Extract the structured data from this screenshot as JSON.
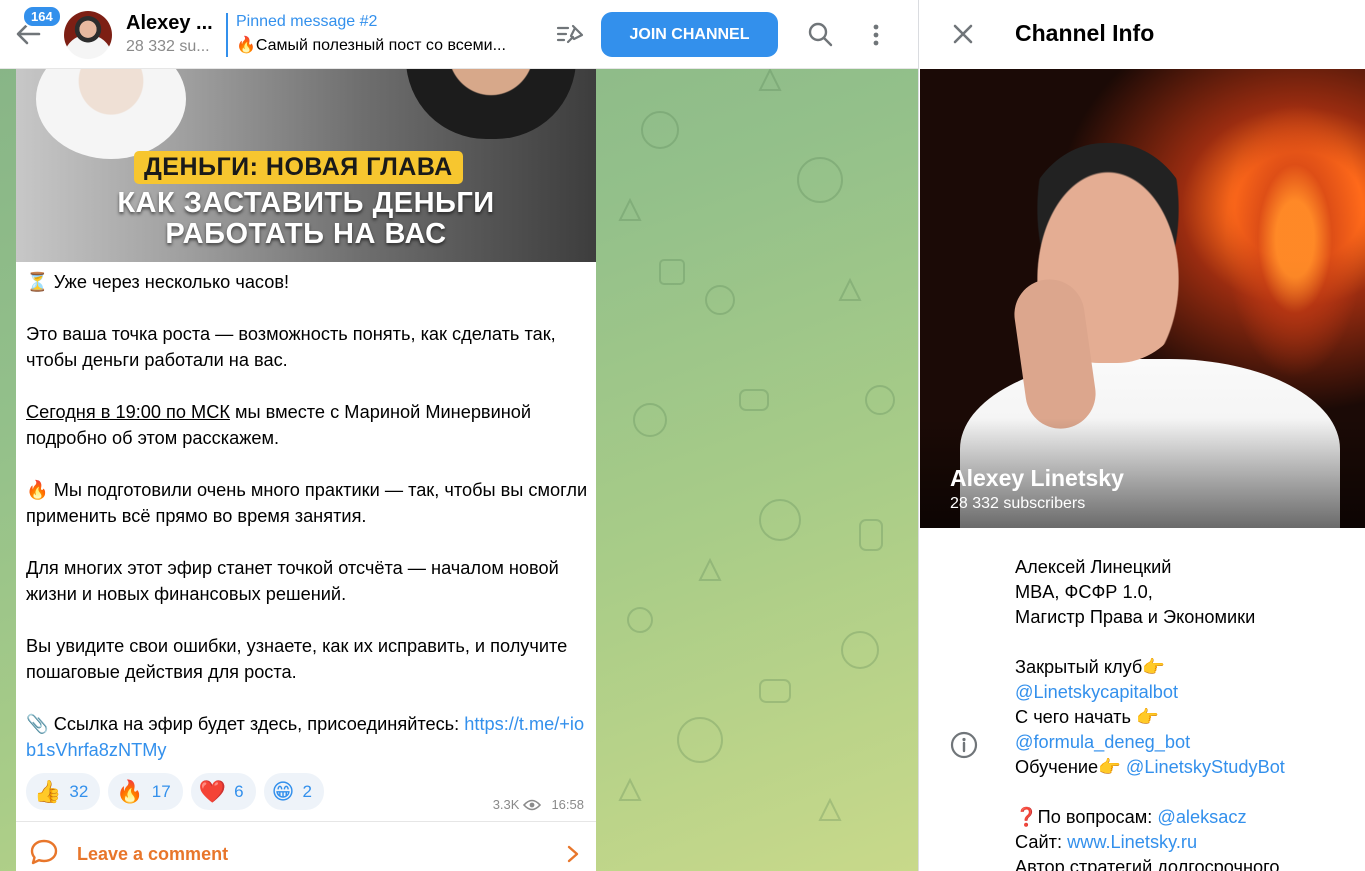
{
  "header": {
    "unread_count": "164",
    "channel_title": "Alexey ...",
    "subscribers": "28 332 su...",
    "pinned_title": "Pinned message #2",
    "pinned_text": "🔥Самый полезный пост со всеми...",
    "join_label": "JOIN CHANNEL"
  },
  "post": {
    "image": {
      "tag": "ДЕНЬГИ: НОВАЯ ГЛАВА",
      "headline_line1": "КАК ЗАСТАВИТЬ ДЕНЬГИ",
      "headline_line2": "РАБОТАТЬ НА ВАС"
    },
    "p1": "⏳ Уже через несколько часов!",
    "p2": "Это ваша точка роста — возможность понять, как сделать так, чтобы деньги работали на вас.",
    "p3_underlined": "Сегодня в 19:00 по МСК",
    "p3_rest": " мы вместе с Мариной Минервиной подробно об этом расскажем.",
    "p4": "🔥 Мы подготовили очень много практики — так, чтобы вы смогли применить всё прямо во время занятия.",
    "p5": "Для многих этот эфир станет точкой отсчёта — началом новой жизни и новых финансовых решений.",
    "p6": "Вы увидите свои ошибки, узнаете, как их исправить, и получите пошаговые действия для роста.",
    "p7_text": "📎 Ссылка на эфир будет здесь, присоединяйтесь: ",
    "p7_link": "https://t.me/+iob1sVhrfa8zNTMy",
    "reactions": [
      {
        "emoji": "👍",
        "count": "32"
      },
      {
        "emoji": "🔥",
        "count": "17"
      },
      {
        "emoji": "❤️",
        "count": "6"
      },
      {
        "emoji": "😁",
        "count": "2"
      }
    ],
    "views": "3.3K",
    "time": "16:58",
    "comment_label": "Leave a comment"
  },
  "info": {
    "title": "Channel Info",
    "name": "Alexey Linetsky",
    "subscribers": "28 332 subscribers",
    "bio": {
      "line1": "Алексей Линецкий",
      "line2": "MBA, ФСФР 1.0,",
      "line3": "Магистр Права и Экономики",
      "line4": "Закрытый клуб👉",
      "line5": "@Linetskycapitalbot",
      "line6": "С чего начать 👉",
      "line7": "@formula_deneg_bot",
      "line8_text": "Обучение👉 ",
      "line8_link": "@LinetskyStudyBot",
      "line9_text": "❓По вопросам: ",
      "line9_link": "@aleksacz",
      "line10_text": "Сайт: ",
      "line10_link": "www.Linetsky.ru",
      "line11": "Автор стратегий долгосрочного"
    }
  },
  "colors": {
    "accent": "#3390ec",
    "comment_orange": "#e8762b",
    "chat_bg": "#93c08a"
  }
}
